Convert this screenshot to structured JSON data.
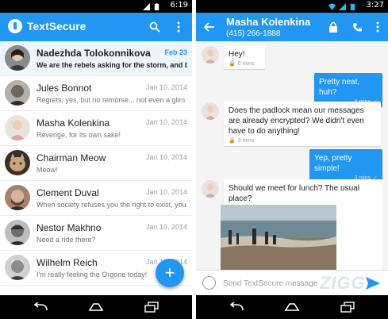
{
  "left_screen": {
    "status_bar": {
      "time": "6:19"
    },
    "toolbar": {
      "title": "TextSecure",
      "search_icon": "search-icon",
      "overflow_icon": "overflow-menu-icon"
    },
    "conversations": [
      {
        "name": "Nadezhda Tolokonnikova",
        "snippet": "We are the rebels asking for the storm, and bel",
        "date": "Feb 23",
        "unread": true
      },
      {
        "name": "Jules Bonnot",
        "snippet": "Regrets, yes, but no remorse... not even a glim",
        "date": "Jan 10, 2014",
        "unread": false
      },
      {
        "name": "Masha Kolenkina",
        "snippet": "Revenge, for its own sake!",
        "date": "Jan 10, 2014",
        "unread": false
      },
      {
        "name": "Chairman Meow",
        "snippet": "Meow!",
        "date": "Jan 10, 2014",
        "unread": false
      },
      {
        "name": "Clement Duval",
        "snippet": "When society refuses you the right to exist, you",
        "date": "Jan 10, 2014",
        "unread": false
      },
      {
        "name": "Nestor Makhno",
        "snippet": "Need a ride there?",
        "date": "Jan 10, 2014",
        "unread": false
      },
      {
        "name": "Wilhelm Reich",
        "snippet": "I'm really feeling the Orgone today!",
        "date": "Jan 10, 2014",
        "unread": false
      }
    ],
    "fab_label": "+"
  },
  "right_screen": {
    "status_bar": {
      "time": "3:27"
    },
    "header": {
      "name": "Masha Kolenkina",
      "number": "(415) 266-1888"
    },
    "messages": [
      {
        "direction": "in",
        "text": "Hey!",
        "meta": "6 mins"
      },
      {
        "direction": "out",
        "text": "Pretty neat, huh?",
        "meta": "4 mins"
      },
      {
        "direction": "in",
        "text": "Does the padlock mean our messages are already encrypted? We didn't even have to do anything!",
        "meta": "3 mins"
      },
      {
        "direction": "out",
        "text": "Yep, pretty simple!",
        "meta": "3 mins"
      },
      {
        "direction": "in",
        "text": "Should we meet for lunch? The usual place?",
        "meta": ""
      }
    ],
    "composer": {
      "placeholder": "Send TextSecure message"
    },
    "watermark": "ZIGG"
  },
  "colors": {
    "primary": "#2196f3",
    "unread_date": "#2196f3",
    "outgoing_bubble": "#2196f3",
    "incoming_bubble": "#ffffff"
  }
}
